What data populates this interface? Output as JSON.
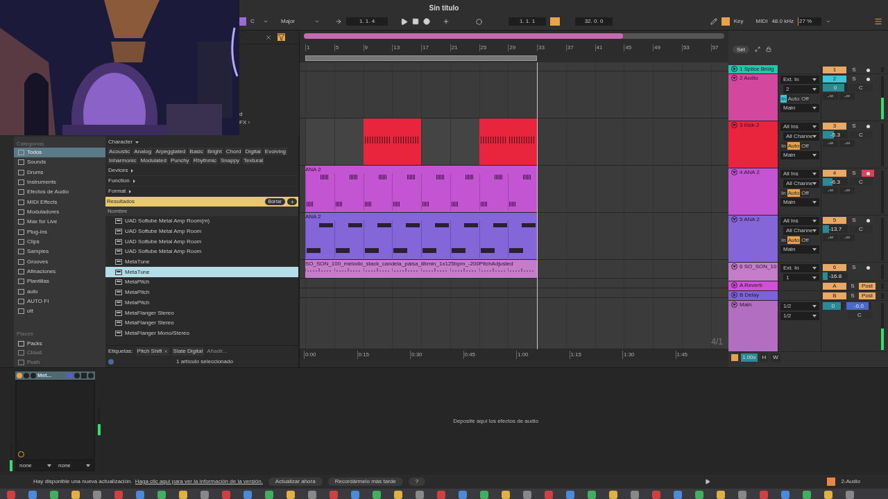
{
  "title": "Sin título",
  "transport": {
    "key": "C",
    "scale": "Major",
    "arrangement_position": "1. 1. 4",
    "loop_start": "1. 1. 1",
    "loop_length": "32. 0. 0",
    "loop_on": true,
    "key_mode_on": true,
    "key_label": "Key",
    "midi_label": "MIDI",
    "sample_rate": "48.0 kHz",
    "cpu": "27 %",
    "cpu_meter": {
      "level": 0.35
    }
  },
  "browser": {
    "fragments": [
      "d",
      "FX ›"
    ],
    "categories_title": "Categorías",
    "categories": [
      {
        "label": "Todos",
        "selected": true
      },
      {
        "label": "Sounds",
        "selected": false
      },
      {
        "label": "Drums",
        "selected": false
      },
      {
        "label": "Instruments",
        "selected": false
      },
      {
        "label": "Efectos de Audio",
        "selected": false
      },
      {
        "label": "MIDI Effects",
        "selected": false
      },
      {
        "label": "Moduladores",
        "selected": false
      },
      {
        "label": "Max for Live",
        "selected": false
      },
      {
        "label": "Plug-ins",
        "selected": false
      },
      {
        "label": "Clips",
        "selected": false
      },
      {
        "label": "Samples",
        "selected": false
      },
      {
        "label": "Grooves",
        "selected": false
      },
      {
        "label": "Afinaciones",
        "selected": false
      },
      {
        "label": "Plantillas",
        "selected": false
      },
      {
        "label": "auto",
        "selected": false
      },
      {
        "label": "AUTO FI",
        "selected": false
      },
      {
        "label": "ott",
        "selected": false
      }
    ],
    "places_title": "Places",
    "places": [
      {
        "label": "Packs",
        "disabled": false
      },
      {
        "label": "Cloud",
        "disabled": true
      },
      {
        "label": "Push",
        "disabled": true
      }
    ],
    "filter_sections": [
      {
        "label": "Character",
        "expanded": true
      },
      {
        "label": "Devices",
        "expanded": false
      },
      {
        "label": "Function",
        "expanded": false
      },
      {
        "label": "Format",
        "expanded": false
      }
    ],
    "tags": [
      "Acoustic",
      "Analog",
      "Arpeggiated",
      "Basic",
      "Bright",
      "Chord",
      "Digital",
      "Evolving",
      "Inharmonic",
      "Modulated",
      "Punchy",
      "Rhythmic",
      "Snappy",
      "Textural"
    ],
    "results_title": "Resultados",
    "clear_button": "Borrar",
    "column": "Nombre",
    "results": [
      {
        "name": "UAD Softube Metal Amp Room(m)",
        "selected": false
      },
      {
        "name": "UAD Softube Metal Amp Room",
        "selected": false
      },
      {
        "name": "UAD Softube Metal Amp Room",
        "selected": false
      },
      {
        "name": "UAD Softube Metal Amp Room",
        "selected": false
      },
      {
        "name": "MetaTune",
        "selected": false
      },
      {
        "name": "MetaTune",
        "selected": true
      },
      {
        "name": "MetaPitch",
        "selected": false
      },
      {
        "name": "MetaPitch",
        "selected": false
      },
      {
        "name": "MetaPitch",
        "selected": false
      },
      {
        "name": "MetaFlanger Stereo",
        "selected": false
      },
      {
        "name": "MetaFlanger Stereo",
        "selected": false
      },
      {
        "name": "MetaFlanger Mono/Stereo",
        "selected": false
      }
    ],
    "labels_title": "Etiquetas:",
    "labels": [
      {
        "text": "Pitch Shift",
        "removable": true
      },
      {
        "text": "Slate Digital",
        "removable": false
      }
    ],
    "label_placeholder": "Añadir...",
    "status": "1 artículo seleccionado"
  },
  "arrangement": {
    "bars": [
      "1",
      "5",
      "9",
      "13",
      "17",
      "21",
      "25",
      "29",
      "33",
      "37",
      "41",
      "45",
      "49",
      "53",
      "57"
    ],
    "set_button": "Set",
    "times": [
      "0:00",
      "0:15",
      "0:30",
      "0:45",
      "1:00",
      "1:15",
      "1:30",
      "1:45"
    ],
    "grid": "4/1"
  },
  "tracks": [
    {
      "kind": "track",
      "name": "1 Splice Bridg",
      "color": "#1ec8a8",
      "expanded": false,
      "mixer": {
        "number": "1",
        "selected": false,
        "solo": "S",
        "armed": false
      }
    },
    {
      "kind": "track",
      "name": "2 Audio",
      "color": "#d4479f",
      "expanded": true,
      "io": {
        "input": "Ext. In",
        "channel": "2",
        "monitor": [
          {
            "label": "In",
            "selected": true
          },
          {
            "label": "Auto",
            "selected": false
          },
          {
            "label": "Off",
            "selected": false
          }
        ],
        "output": "Main"
      },
      "mixer": {
        "number": "2",
        "selected": true,
        "solo": "S",
        "armed": false,
        "volume": "0",
        "level": 0.85,
        "pan": "C",
        "sends": [
          "-∞",
          "-∞"
        ]
      },
      "meter": {
        "level": 0.5
      }
    },
    {
      "kind": "track",
      "name": "3 Kick 2",
      "color": "#e8253c",
      "expanded": true,
      "clip": {
        "kind": "midi",
        "cells": [
          false,
          false,
          true,
          true,
          false,
          false,
          true,
          true
        ]
      },
      "io": {
        "input": "All Ins",
        "channel": "All Channe",
        "monitor": [
          {
            "label": "In",
            "selected": false
          },
          {
            "label": "Auto",
            "selected": true
          },
          {
            "label": "Off",
            "selected": false
          }
        ],
        "output": "Main"
      },
      "mixer": {
        "number": "3",
        "selected": false,
        "solo": "S",
        "armed": false,
        "volume": "-5.3",
        "level": 0.45,
        "pan": "C",
        "sends": [
          "-∞",
          "-∞"
        ]
      }
    },
    {
      "kind": "track",
      "name": "4 ANA 2",
      "color": "#c455d2",
      "expanded": true,
      "clip": {
        "kind": "pattern",
        "name": "ANA 2",
        "cells": [
          true,
          true,
          true,
          true,
          true,
          true,
          true,
          true
        ]
      },
      "io": {
        "input": "All Ins",
        "channel": "All Channe",
        "monitor": [
          {
            "label": "In",
            "selected": false
          },
          {
            "label": "Auto",
            "selected": true
          },
          {
            "label": "Off",
            "selected": false
          }
        ],
        "output": "Main"
      },
      "mixer": {
        "number": "4",
        "selected": false,
        "solo": "S",
        "armed": true,
        "volume": "-6.3",
        "level": 0.4,
        "pan": "C",
        "sends": [
          "-∞",
          "-∞"
        ]
      }
    },
    {
      "kind": "track",
      "name": "5 ANA 2",
      "color": "#8466d8",
      "expanded": true,
      "clip": {
        "kind": "blocks",
        "name": "ANA 2",
        "cells": [
          true,
          true,
          true,
          true,
          true,
          true,
          true,
          true
        ]
      },
      "io": {
        "input": "All Ins",
        "channel": "All Channe",
        "monitor": [
          {
            "label": "In",
            "selected": false
          },
          {
            "label": "Auto",
            "selected": true
          },
          {
            "label": "Off",
            "selected": false
          }
        ],
        "output": "Main"
      },
      "mixer": {
        "number": "5",
        "selected": false,
        "solo": "S",
        "armed": false,
        "volume": "-13.7",
        "level": 0.25,
        "pan": "C",
        "sends": [
          "-∞",
          "-∞"
        ]
      }
    },
    {
      "kind": "track",
      "name": "6 SO_SON_10",
      "color": "#c57dca",
      "expanded": true,
      "clip": {
        "kind": "audio",
        "name": "SO_SON_100_melodic_stack_candela_paisa_8bmin_1x125bpm_-200PitchAdjusted",
        "cells": [
          true,
          true,
          true,
          true,
          true,
          true,
          true,
          true
        ]
      },
      "io": {
        "input": "Ext. In",
        "channel": "1"
      },
      "mixer": {
        "number": "6",
        "selected": false,
        "solo": "S",
        "armed": false,
        "volume": "-16.8",
        "level": 0.2
      }
    },
    {
      "kind": "return",
      "name": "A Reverb",
      "color": "#d24fd8",
      "expanded": false,
      "mixer": {
        "number": "A",
        "selected": false,
        "solo": "S",
        "post": "Post"
      }
    },
    {
      "kind": "return",
      "name": "B Delay",
      "color": "#7d62d9",
      "expanded": false,
      "mixer": {
        "number": "B",
        "selected": false,
        "solo": "S",
        "post": "Post"
      }
    },
    {
      "kind": "main",
      "name": "Main",
      "color": "#b26fc2",
      "expanded": true,
      "io": {
        "input": "1/2",
        "channel": "1/2"
      },
      "mixer": {
        "volume": "0",
        "level": 0.85,
        "cue": {
          "volume": "-6.0",
          "level": 0.9
        },
        "pan": "C"
      },
      "meter": {
        "level": 0.45
      }
    }
  ],
  "mixer_footer": {
    "zoom": "1.00x",
    "buttons": [
      "H",
      "W"
    ]
  },
  "device": {
    "name": "Met...",
    "on": true,
    "selectors": [
      "none",
      "none"
    ],
    "meter": {
      "level": 0.4
    }
  },
  "drop_hint": "Deposite aquí los efectos de audio",
  "status_bar": {
    "message": "Hay disponible una nueva actualización.",
    "link": "Haga clic aquí para ver la información de la versión.",
    "buttons": [
      "Actualizar ahora",
      "Recordármelo más tarde",
      "?"
    ],
    "track": "2-Audio"
  }
}
